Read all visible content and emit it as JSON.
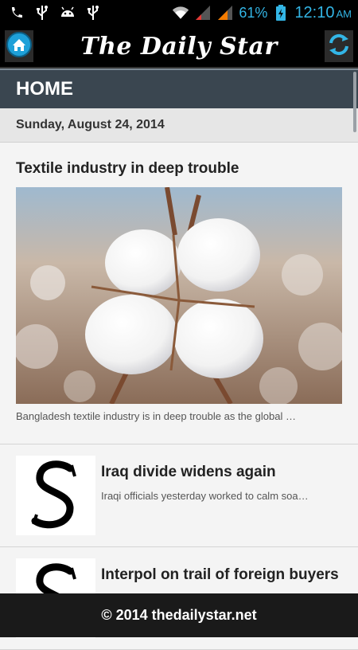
{
  "status_bar": {
    "icons": [
      "phone-icon",
      "usb-icon",
      "android-icon",
      "usb-icon",
      "wifi-icon",
      "signal-1-icon",
      "signal-2-icon",
      "battery-icon"
    ],
    "battery_percent": "61%",
    "time": "12:10",
    "am_pm": "AM",
    "accent_color": "#33b5e5"
  },
  "app_bar": {
    "masthead": "The Daily Star",
    "left_icon": "home-icon",
    "right_icon": "refresh-icon"
  },
  "section": {
    "title": "HOME"
  },
  "date_line": "Sunday, August 24, 2014",
  "feature": {
    "title": "Textile industry in deep trouble",
    "summary": "Bangladesh textile industry is in deep trouble as the global …",
    "image_icon": "cotton-boll-photo"
  },
  "articles": [
    {
      "title": "Iraq divide widens again",
      "summary": "Iraqi officials yesterday worked to calm soa…",
      "thumb_icon": "daily-star-s-logo"
    },
    {
      "title": "Interpol on trail of foreign buyers",
      "summary": "",
      "thumb_icon": "daily-star-s-logo"
    }
  ],
  "footer": {
    "text": "© 2014 thedailystar.net"
  }
}
